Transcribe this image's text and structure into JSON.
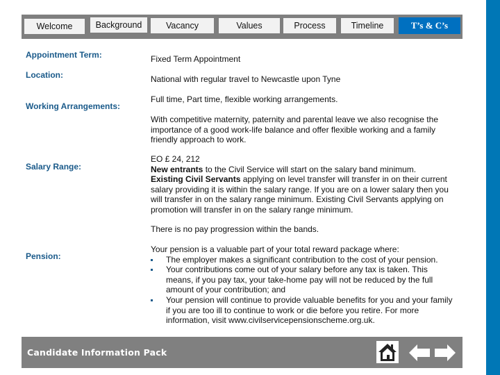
{
  "nav": {
    "tabs": [
      {
        "label": "Welcome",
        "active": false
      },
      {
        "label": "Background",
        "active": false
      },
      {
        "label": "Vacancy",
        "active": false
      },
      {
        "label": "Values",
        "active": false
      },
      {
        "label": "Process",
        "active": false
      },
      {
        "label": "Timeline",
        "active": false
      },
      {
        "label": "T’s & C’s",
        "active": true
      }
    ]
  },
  "terms": {
    "appointment_term": {
      "label": "Appointment Term:",
      "value": "Fixed Term Appointment"
    },
    "location": {
      "label": "Location:",
      "value": "National with regular travel to Newcastle upon Tyne"
    },
    "working_arrangements": {
      "label": "Working Arrangements:",
      "value": "Full time, Part time, flexible working arrangements.",
      "extra": "With competitive maternity, paternity and parental leave we also recognise the importance of a good work-life balance and offer flexible working and a family friendly approach to work."
    },
    "salary_range": {
      "label": "Salary Range:",
      "band": "EO £ 24, 212",
      "new_entrants_bold": "New entrants",
      "new_entrants_text": " to the Civil Service will start on the salary band minimum.",
      "existing_bold": "Existing Civil Servants",
      "existing_text": " applying on level transfer will transfer in on their current salary providing it is within the salary range. If you are on a lower salary then you will transfer in on the salary range minimum. Existing Civil Servants applying on promotion will transfer in on the salary range minimum.",
      "no_progression": "There is no pay progression within the bands."
    },
    "pension": {
      "label": "Pension:",
      "intro": "Your pension is a valuable part of your total reward package where:",
      "bullets": [
        "The employer makes a significant contribution to the cost of your pension.",
        "Your contributions come out of your salary before any tax is taken. This means, if you pay tax, your take-home pay will not be reduced by the full amount of your contribution; and",
        "Your pension will continue to provide valuable benefits for you and your family if you are too ill to continue to work or die before you retire. For more information, visit www.civilservicepensionscheme.org.uk."
      ]
    }
  },
  "footer": {
    "title": "Candidate Information Pack",
    "home_icon": "home-icon",
    "back_icon": "arrow-left-icon",
    "forward_icon": "arrow-right-icon"
  },
  "colors": {
    "accent_blue": "#0070c0",
    "side_bar_blue": "#0077b6",
    "label_blue": "#1a5a8a",
    "bar_gray": "#7f7f7f"
  }
}
